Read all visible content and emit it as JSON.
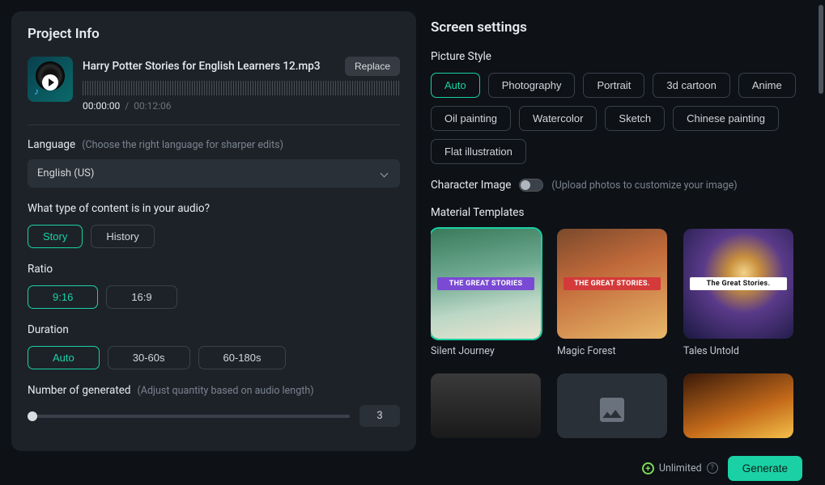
{
  "project": {
    "title": "Project Info",
    "audio": {
      "filename": "Harry Potter Stories for English Learners 12.mp3",
      "replace_label": "Replace",
      "time_current": "00:00:00",
      "time_total": "00:12:06"
    },
    "language": {
      "label": "Language",
      "hint": "(Choose the right language for sharper edits)",
      "value": "English (US)"
    },
    "content_type": {
      "label": "What type of content is in your audio?",
      "options": [
        "Story",
        "History"
      ],
      "selected": "Story"
    },
    "ratio": {
      "label": "Ratio",
      "options": [
        "9:16",
        "16:9"
      ],
      "selected": "9:16"
    },
    "duration": {
      "label": "Duration",
      "options": [
        "Auto",
        "30-60s",
        "60-180s"
      ],
      "selected": "Auto"
    },
    "generated": {
      "label": "Number of generated",
      "hint": "(Adjust quantity based on audio length)",
      "value": "3"
    }
  },
  "screen": {
    "title": "Screen settings",
    "picture_style": {
      "label": "Picture Style",
      "options": [
        "Auto",
        "Photography",
        "Portrait",
        "3d cartoon",
        "Anime",
        "Oil painting",
        "Watercolor",
        "Sketch",
        "Chinese painting",
        "Flat illustration"
      ],
      "selected": "Auto"
    },
    "character_image": {
      "label": "Character Image",
      "hint": "(Upload photos to customize your image)",
      "enabled": false
    },
    "templates": {
      "label": "Material Templates",
      "items": [
        {
          "name": "Silent Journey",
          "caption": "THE GREAT STORIES",
          "selected": true
        },
        {
          "name": "Magic Forest",
          "caption": "THE GREAT STORIES.",
          "selected": false
        },
        {
          "name": "Tales Untold",
          "caption": "The Great Stories.",
          "selected": false
        }
      ]
    }
  },
  "footer": {
    "unlimited_label": "Unlimited",
    "generate_label": "Generate"
  }
}
